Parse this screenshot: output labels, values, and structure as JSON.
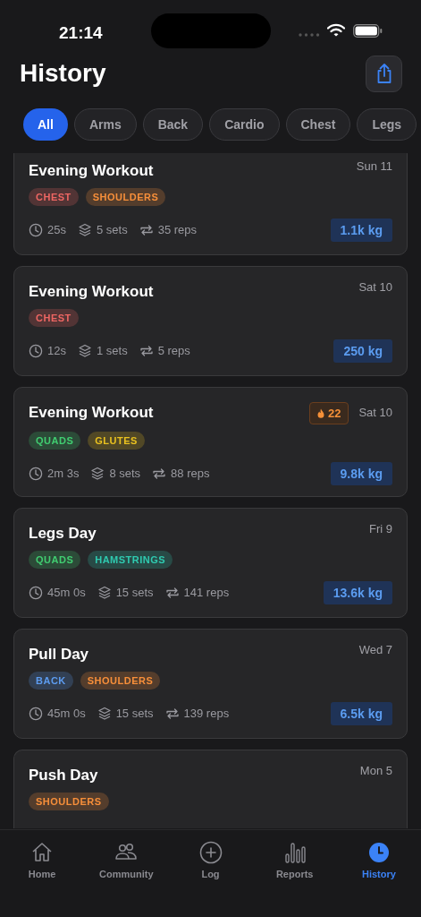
{
  "status_bar": {
    "time": "21:14"
  },
  "header": {
    "title": "History"
  },
  "filters": [
    {
      "label": "All",
      "selected": true
    },
    {
      "label": "Arms",
      "selected": false
    },
    {
      "label": "Back",
      "selected": false
    },
    {
      "label": "Cardio",
      "selected": false
    },
    {
      "label": "Chest",
      "selected": false
    },
    {
      "label": "Legs",
      "selected": false
    }
  ],
  "workouts": [
    {
      "title": "Evening Workout",
      "date": "Sun 11",
      "tags": [
        {
          "label": "CHEST",
          "color": "#523435"
        },
        {
          "label": "SHOULDERS",
          "color": "#543d2c"
        }
      ],
      "duration": "25s",
      "sets": "5 sets",
      "reps": "35 reps",
      "volume": "1.1k kg"
    },
    {
      "title": "Evening Workout",
      "date": "Sat 10",
      "tags": [
        {
          "label": "CHEST",
          "color": "#523435"
        }
      ],
      "duration": "12s",
      "sets": "1 sets",
      "reps": "5 reps",
      "volume": "250 kg"
    },
    {
      "title": "Evening Workout",
      "date": "Sat 10",
      "streak": "22",
      "tags": [
        {
          "label": "QUADS",
          "color": "#2c4b38"
        },
        {
          "label": "GLUTES",
          "color": "#514826"
        }
      ],
      "duration": "2m 3s",
      "sets": "8 sets",
      "reps": "88 reps",
      "volume": "9.8k kg"
    },
    {
      "title": "Legs Day",
      "date": "Fri 9",
      "tags": [
        {
          "label": "QUADS",
          "color": "#2c4b38"
        },
        {
          "label": "HAMSTRINGS",
          "color": "#284a46"
        }
      ],
      "duration": "45m 0s",
      "sets": "15 sets",
      "reps": "141 reps",
      "volume": "13.6k kg"
    },
    {
      "title": "Pull Day",
      "date": "Wed 7",
      "tags": [
        {
          "label": "BACK",
          "color": "#324054"
        },
        {
          "label": "SHOULDERS",
          "color": "#543d2c"
        }
      ],
      "duration": "45m 0s",
      "sets": "15 sets",
      "reps": "139 reps",
      "volume": "6.5k kg"
    },
    {
      "title": "Push Day",
      "date": "Mon 5",
      "tags": [
        {
          "label": "SHOULDERS",
          "color": "#543d2c"
        }
      ]
    }
  ],
  "tab_bar": [
    {
      "label": "Home",
      "selected": false
    },
    {
      "label": "Community",
      "selected": false
    },
    {
      "label": "Log",
      "selected": false
    },
    {
      "label": "Reports",
      "selected": false
    },
    {
      "label": "History",
      "selected": true
    }
  ]
}
